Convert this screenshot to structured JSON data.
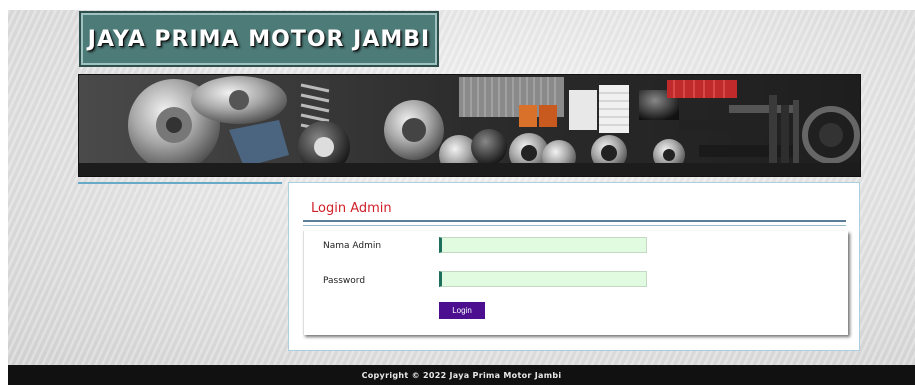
{
  "header": {
    "site_title": "JAYA PRIMA MOTOR JAMBI"
  },
  "login": {
    "title": "Login Admin",
    "fields": [
      {
        "label": "Nama Admin",
        "value": "",
        "placeholder": ""
      },
      {
        "label": "Password",
        "value": "",
        "placeholder": ""
      }
    ],
    "submit_label": "Login"
  },
  "footer": {
    "copyright": "Copyright © 2022 Jaya Prima Motor Jambi"
  },
  "colors": {
    "logo_bg": "#4d7b78",
    "title_red": "#d0202c",
    "input_bg": "#e1fbe1",
    "button_purple": "#4b0f8f",
    "footer_bg": "#111111"
  },
  "icons": {
    "banner": "auto-parts-banner-image"
  }
}
